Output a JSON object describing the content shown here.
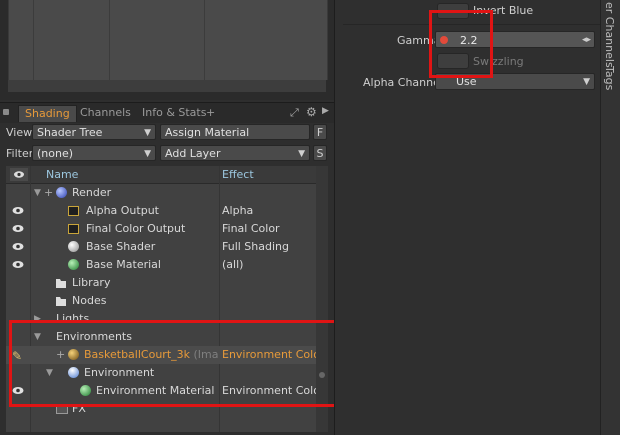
{
  "tabs": [
    "Shading",
    "Channels",
    "Info & Stats"
  ],
  "tab_add": "+",
  "view_row": {
    "label": "View",
    "value": "Shader Tree",
    "button": "Assign Material",
    "key": "F"
  },
  "filter_row": {
    "label": "Filter",
    "value": "(none)",
    "button": "Add Layer",
    "key": "S"
  },
  "columns": {
    "name": "Name",
    "effect": "Effect"
  },
  "tree": [
    {
      "name": "Render",
      "effect": ""
    },
    {
      "name": "Alpha Output",
      "effect": "Alpha"
    },
    {
      "name": "Final Color Output",
      "effect": "Final Color"
    },
    {
      "name": "Base Shader",
      "effect": "Full Shading"
    },
    {
      "name": "Base Material",
      "effect": "(all)"
    },
    {
      "name": "Library",
      "effect": ""
    },
    {
      "name": "Nodes",
      "effect": ""
    },
    {
      "name": "Lights",
      "effect": ""
    },
    {
      "name": "Environments",
      "effect": ""
    },
    {
      "name": "BasketballCourt_3k",
      "suffix": "(Ima ...",
      "effect": "Environment Color"
    },
    {
      "name": "Environment",
      "effect": ""
    },
    {
      "name": "Environment Material",
      "effect": "Environment Color"
    },
    {
      "name": "FX",
      "effect": ""
    }
  ],
  "properties": {
    "invert_blue": "Invert Blue",
    "gamma_label": "Gamma",
    "gamma_value": "2.2",
    "swizzling": "Swizzling",
    "alpha_label": "Alpha Channel",
    "alpha_value": "Use"
  },
  "side_tabs": [
    "er Channels",
    "Tags"
  ],
  "colors": {
    "accent": "#e79a3a",
    "highlight": "#e01414",
    "header_text": "#9cc7df"
  }
}
